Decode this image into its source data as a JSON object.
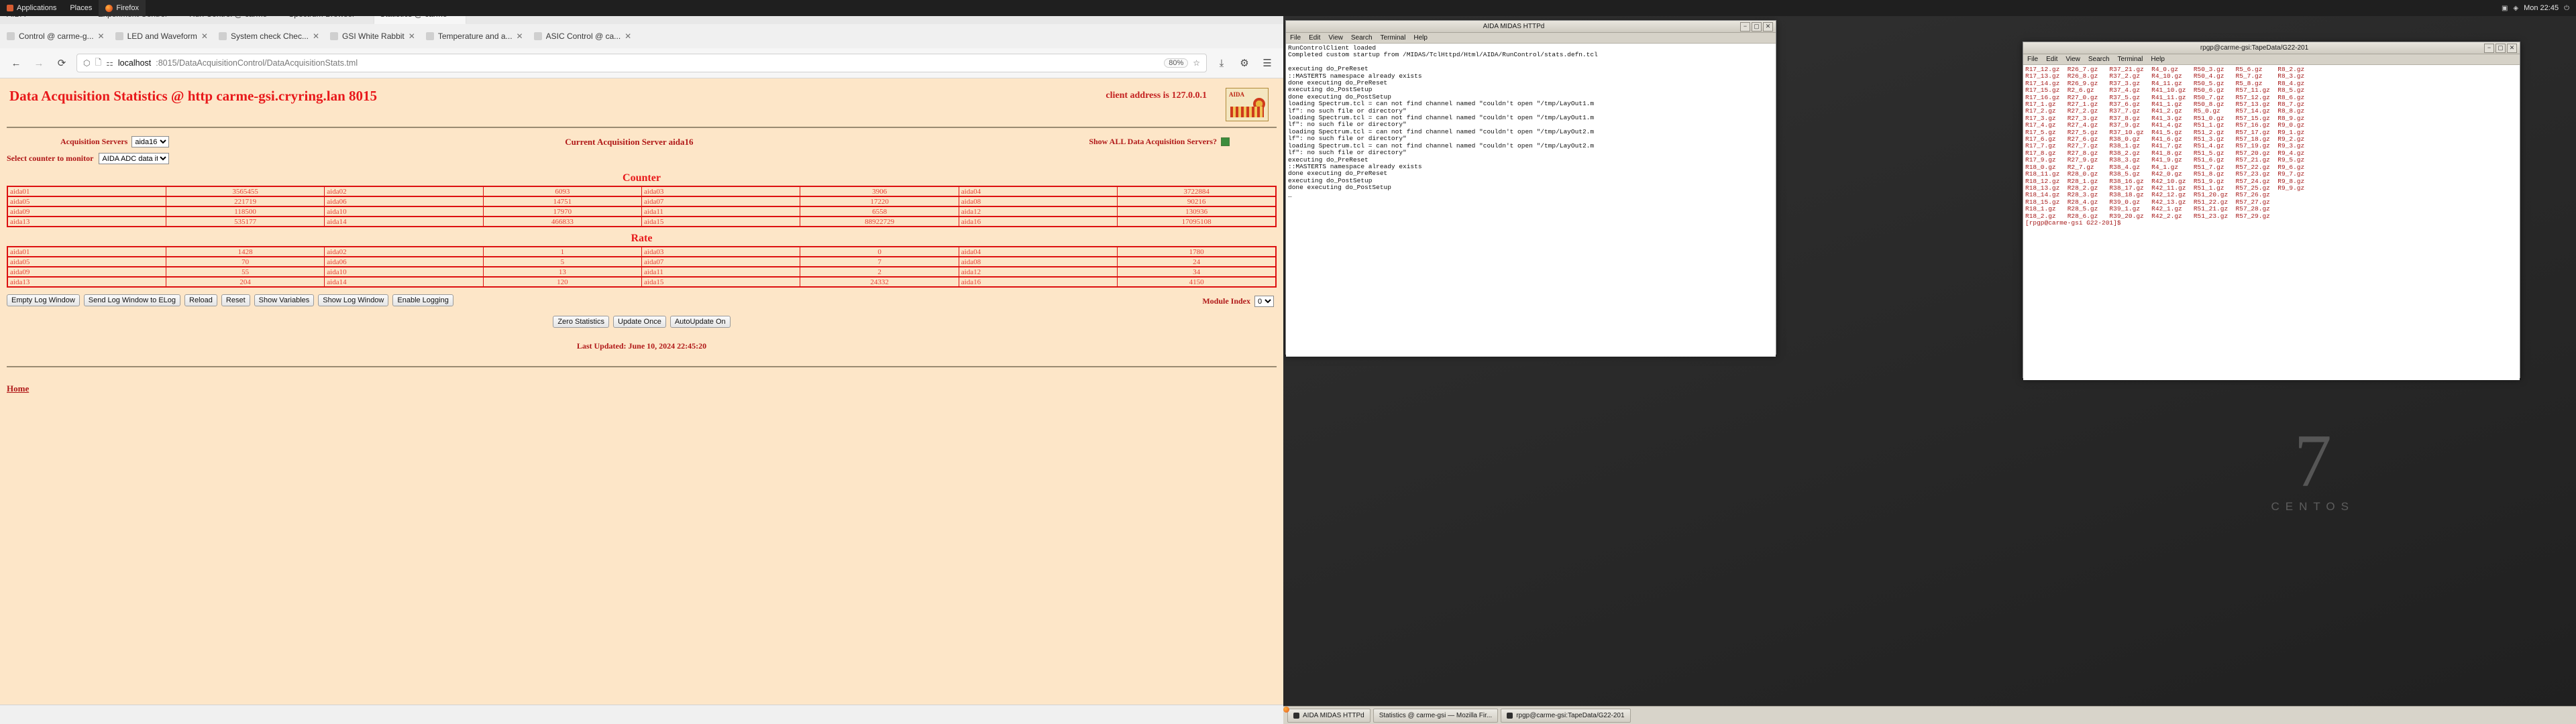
{
  "desktop": {
    "panel": {
      "app_menu": "Applications",
      "places_menu": "Places",
      "active_app": "Firefox",
      "clock": "Mon 22:45",
      "tray_icons": [
        "network-icon",
        "volume-icon",
        "power-icon"
      ]
    },
    "watermark": {
      "number": "7",
      "caption": "CENTOS"
    }
  },
  "browser": {
    "tabs_row1": [
      {
        "title": "AIDA",
        "selected": false
      },
      {
        "title": "Experiment Control",
        "selected": false
      },
      {
        "title": "Run Control @ carme",
        "selected": false
      },
      {
        "title": "Spectrum Browser",
        "selected": false
      },
      {
        "title": "Statistics @ carme",
        "selected": true
      }
    ],
    "tabs_row2": [
      {
        "title": "Control @ carme-g..."
      },
      {
        "title": "LED and Waveform"
      },
      {
        "title": "System check Chec..."
      },
      {
        "title": "GSI White Rabbit"
      },
      {
        "title": "Temperature and a..."
      },
      {
        "title": "ASIC Control @ ca..."
      }
    ],
    "nav": {
      "back_icon": "back-arrow-icon",
      "forward_icon": "forward-arrow-icon",
      "reload_icon": "reload-icon",
      "shield_icon": "shield-icon",
      "page_icon": "page-icon",
      "reader_icon": "reader-mode-icon",
      "zoom_level": "80%",
      "bookmark_icon": "star-icon",
      "save_icon": "save-icon",
      "extensions_icon": "extensions-icon",
      "menu_icon": "hamburger-menu-icon"
    },
    "url": {
      "host": "localhost",
      "path": ":8015/DataAcquisitionControl/DataAcquisitionStats.tml"
    }
  },
  "page": {
    "title": "Data Acquisition Statistics @ http carme-gsi.cryring.lan 8015",
    "client_address": "client address is 127.0.0.1",
    "logo_label": "AIDA",
    "acq_servers_label": "Acquisition Servers",
    "acq_servers_value": "aida16",
    "current_server_label": "Current Acquisition Server aida16",
    "show_all_label": "Show ALL Data Acquisition Servers?",
    "show_all_checked": true,
    "counter_select_label": "Select counter to monitor",
    "counter_select_value": "AIDA ADC data items",
    "counter_heading": "Counter",
    "rate_heading": "Rate",
    "counter_rows": [
      [
        {
          "n": "aida01",
          "v": "3565455"
        },
        {
          "n": "aida02",
          "v": "6093"
        },
        {
          "n": "aida03",
          "v": "3906"
        },
        {
          "n": "aida04",
          "v": "3722884"
        }
      ],
      [
        {
          "n": "aida05",
          "v": "221719"
        },
        {
          "n": "aida06",
          "v": "14751"
        },
        {
          "n": "aida07",
          "v": "17220"
        },
        {
          "n": "aida08",
          "v": "90216"
        }
      ],
      [
        {
          "n": "aida09",
          "v": "118500"
        },
        {
          "n": "aida10",
          "v": "17970"
        },
        {
          "n": "aida11",
          "v": "6558"
        },
        {
          "n": "aida12",
          "v": "130936"
        }
      ],
      [
        {
          "n": "aida13",
          "v": "535177"
        },
        {
          "n": "aida14",
          "v": "466833"
        },
        {
          "n": "aida15",
          "v": "88922729"
        },
        {
          "n": "aida16",
          "v": "17095108"
        }
      ]
    ],
    "rate_rows": [
      [
        {
          "n": "aida01",
          "v": "1428"
        },
        {
          "n": "aida02",
          "v": "1"
        },
        {
          "n": "aida03",
          "v": "0"
        },
        {
          "n": "aida04",
          "v": "1780"
        }
      ],
      [
        {
          "n": "aida05",
          "v": "70"
        },
        {
          "n": "aida06",
          "v": "5"
        },
        {
          "n": "aida07",
          "v": "7"
        },
        {
          "n": "aida08",
          "v": "24"
        }
      ],
      [
        {
          "n": "aida09",
          "v": "55"
        },
        {
          "n": "aida10",
          "v": "13"
        },
        {
          "n": "aida11",
          "v": "2"
        },
        {
          "n": "aida12",
          "v": "34"
        }
      ],
      [
        {
          "n": "aida13",
          "v": "204"
        },
        {
          "n": "aida14",
          "v": "120"
        },
        {
          "n": "aida15",
          "v": "24332"
        },
        {
          "n": "aida16",
          "v": "4150"
        }
      ]
    ],
    "log_buttons": [
      "Empty Log Window",
      "Send Log Window to ELog",
      "Reload",
      "Reset",
      "Show Variables",
      "Show Log Window",
      "Enable Logging"
    ],
    "module_index_label": "Module Index",
    "module_index_value": "0",
    "action_buttons": [
      "Zero Statistics",
      "Update Once",
      "AutoUpdate On"
    ],
    "last_updated": "Last Updated: June 10, 2024 22:45:20",
    "home_link": "Home"
  },
  "midas_window": {
    "title": "AIDA MIDAS HTTPd",
    "menus": [
      "File",
      "Edit",
      "View",
      "Search",
      "Terminal",
      "Help"
    ],
    "min_icon": "minimize-icon",
    "max_icon": "maximize-icon",
    "close_icon": "close-icon",
    "lines": [
      "RunControlClient loaded",
      "Completed custom startup from /MIDAS/TclHttpd/Html/AIDA/RunControl/stats.defn.tcl",
      "",
      "executing do_PreReset",
      "::MASTERTS namespace already exists",
      "done executing do_PreReset",
      "executing do_PostSetup",
      "done executing do_PostSetup",
      "loading Spectrum.tcl = can not find channel named \"couldn't open \"/tmp/LayOut1.m",
      "lf\": no such file or directory\"",
      "loading Spectrum.tcl = can not find channel named \"couldn't open \"/tmp/LayOut1.m",
      "lf\": no such file or directory\"",
      "loading Spectrum.tcl = can not find channel named \"couldn't open \"/tmp/LayOut2.m",
      "lf\": no such file or directory\"",
      "loading Spectrum.tcl = can not find channel named \"couldn't open \"/tmp/LayOut2.m",
      "lf\": no such file or directory\"",
      "executing do_PreReset",
      "::MASTERTS namespace already exists",
      "done executing do_PreReset",
      "executing do_PostSetup",
      "done executing do_PostSetup",
      "_"
    ]
  },
  "tape_window": {
    "title": "rpgp@carme-gsi:TapeData/G22-201",
    "menus": [
      "File",
      "Edit",
      "View",
      "Search",
      "Terminal",
      "Help"
    ],
    "min_icon": "minimize-icon",
    "max_icon": "maximize-icon",
    "close_icon": "close-icon",
    "lines": [
      "R17_12.gz  R26_7.gz   R37_21.gz  R4_0.gz    R50_3.gz   R5_6.gz    R8_2.gz",
      "R17_13.gz  R26_8.gz   R37_2.gz   R4_10.gz   R50_4.gz   R5_7.gz    R8_3.gz",
      "R17_14.gz  R26_9.gz   R37_3.gz   R4_11.gz   R50_5.gz   R5_8.gz    R8_4.gz",
      "R17_15.gz  R2_6.gz    R37_4.gz   R41_10.gz  R50_6.gz   R57_11.gz  R8_5.gz",
      "R17_16.gz  R27_0.gz   R37_5.gz   R41_11.gz  R50_7.gz   R57_12.gz  R8_6.gz",
      "R17_1.gz   R27_1.gz   R37_6.gz   R41_1.gz   R50_8.gz   R57_13.gz  R8_7.gz",
      "R17_2.gz   R27_2.gz   R37_7.gz   R41_2.gz   R5_0.gz    R57_14.gz  R8_8.gz",
      "R17_3.gz   R27_3.gz   R37_8.gz   R41_3.gz   R51_0.gz   R57_15.gz  R8_9.gz",
      "R17_4.gz   R27_4.gz   R37_9.gz   R41_4.gz   R51_1.gz   R57_16.gz  R9_0.gz",
      "R17_5.gz   R27_5.gz   R37_10.gz  R41_5.gz   R51_2.gz   R57_17.gz  R9_1.gz",
      "R17_6.gz   R27_6.gz   R38_0.gz   R41_6.gz   R51_3.gz   R57_18.gz  R9_2.gz",
      "R17_7.gz   R27_7.gz   R38_1.gz   R41_7.gz   R51_4.gz   R57_19.gz  R9_3.gz",
      "R17_8.gz   R27_8.gz   R38_2.gz   R41_8.gz   R51_5.gz   R57_20.gz  R9_4.gz",
      "R17_9.gz   R27_9.gz   R38_3.gz   R41_9.gz   R51_6.gz   R57_21.gz  R9_5.gz",
      "R18_0.gz   R2_7.gz    R38_4.gz   R4_1.gz    R51_7.gz   R57_22.gz  R9_6.gz",
      "R18_11.gz  R28_0.gz   R38_5.gz   R42_0.gz   R51_8.gz   R57_23.gz  R9_7.gz",
      "R18_12.gz  R28_1.gz   R38_16.gz  R42_10.gz  R51_9.gz   R57_24.gz  R9_8.gz",
      "R18_13.gz  R28_2.gz   R38_17.gz  R42_11.gz  R51_1.gz   R57_25.gz  R9_9.gz",
      "R18_14.gz  R28_3.gz   R38_18.gz  R42_12.gz  R51_20.gz  R57_26.gz",
      "R18_15.gz  R28_4.gz   R39_0.gz   R42_13.gz  R51_22.gz  R57_27.gz",
      "R18_1.gz   R28_5.gz   R39_1.gz   R42_1.gz   R51_21.gz  R57_28.gz",
      "R18_2.gz   R28_6.gz   R39_20.gz  R42_2.gz   R51_23.gz  R57_29.gz"
    ],
    "prompt": "[rpgp@carme-gsi G22-201]$ "
  },
  "taskbar": {
    "items": [
      {
        "label": "AIDA MIDAS HTTPd",
        "icon": "terminal-icon"
      },
      {
        "label": "Statistics @ carme-gsi — Mozilla Fir...",
        "icon": "firefox-icon"
      },
      {
        "label": "rpgp@carme-gsi:TapeData/G22-201",
        "icon": "terminal-icon"
      }
    ]
  }
}
